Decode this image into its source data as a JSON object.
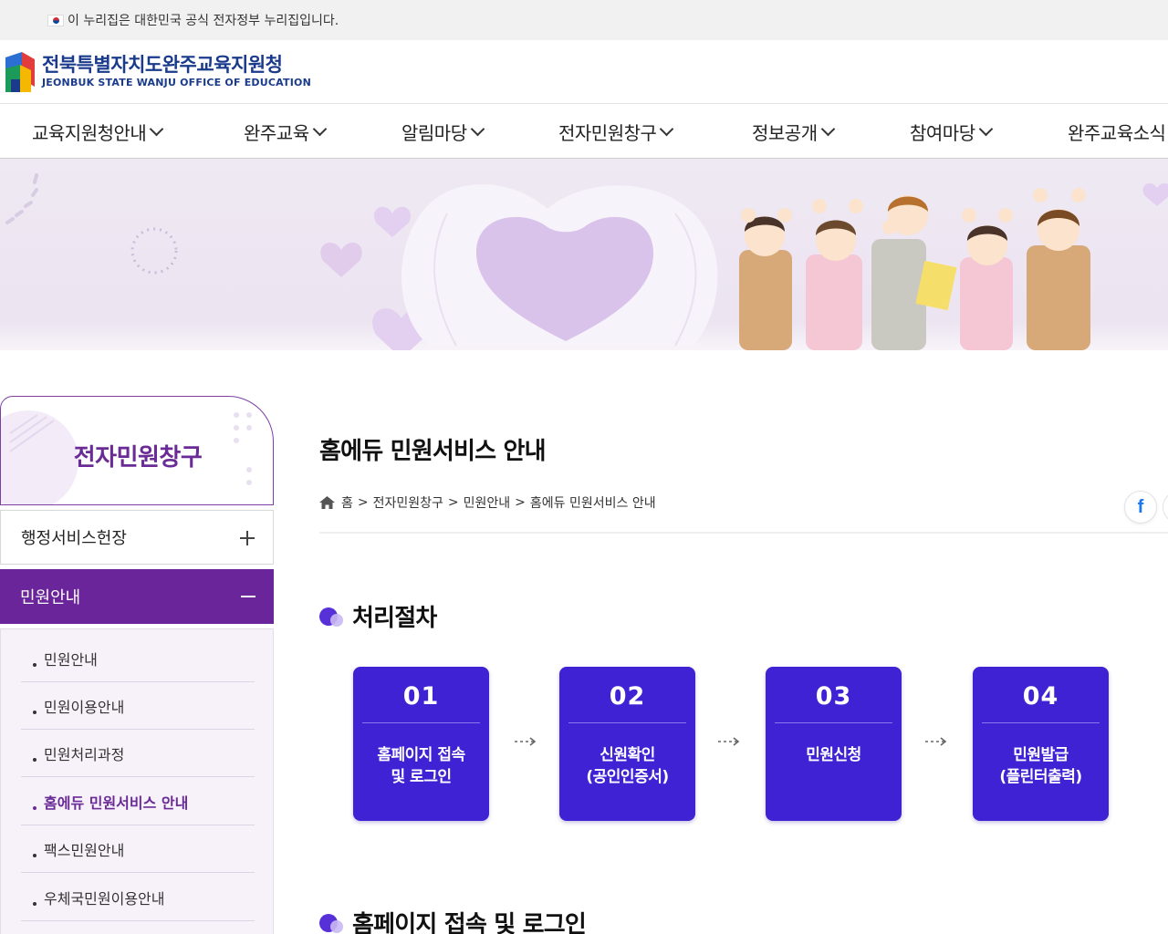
{
  "gov_banner": {
    "text": "이 누리집은 대한민국 공식 전자정부 누리집입니다."
  },
  "header": {
    "logo_ko": "전북특별자치도완주교육지원청",
    "logo_en": "JEONBUK STATE WANJU OFFICE OF EDUCATION"
  },
  "nav": {
    "items": [
      {
        "label": "교육지원청안내"
      },
      {
        "label": "완주교육"
      },
      {
        "label": "알림마당"
      },
      {
        "label": "전자민원창구"
      },
      {
        "label": "정보공개"
      },
      {
        "label": "참여마당"
      },
      {
        "label": "완주교육소식"
      }
    ]
  },
  "sidebar": {
    "title": "전자민원창구",
    "menus": [
      {
        "label": "행정서비스헌장"
      },
      {
        "label": "민원안내"
      }
    ],
    "sub_items": [
      {
        "label": "민원안내"
      },
      {
        "label": "민원이용안내"
      },
      {
        "label": "민원처리과정"
      },
      {
        "label": "홈에듀 민원서비스 안내"
      },
      {
        "label": "팩스민원안내"
      },
      {
        "label": "우체국민원이용안내"
      }
    ]
  },
  "main": {
    "title": "홈에듀 민원서비스 안내",
    "breadcrumb": [
      "홈",
      "전자민원창구",
      "민원안내",
      "홈에듀 민원서비스 안내"
    ],
    "breadcrumb_sep": ">",
    "share": {
      "facebook": "f"
    },
    "section1": "처리절차",
    "steps": [
      {
        "num": "01",
        "line1": "홈페이지 접속",
        "line2": "및 로그인"
      },
      {
        "num": "02",
        "line1": "신원확인",
        "line2": "(공인인증서)"
      },
      {
        "num": "03",
        "line1": "민원신청",
        "line2": ""
      },
      {
        "num": "04",
        "line1": "민원발급",
        "line2": "(플린터출력)"
      }
    ],
    "section2": "홈페이지 접속 및 로그인"
  },
  "colors": {
    "brand_purple": "#6b259a",
    "step_blue": "#3f22d4",
    "logo_navy": "#1a3b8c",
    "hero_bg": "#ece4f1"
  }
}
